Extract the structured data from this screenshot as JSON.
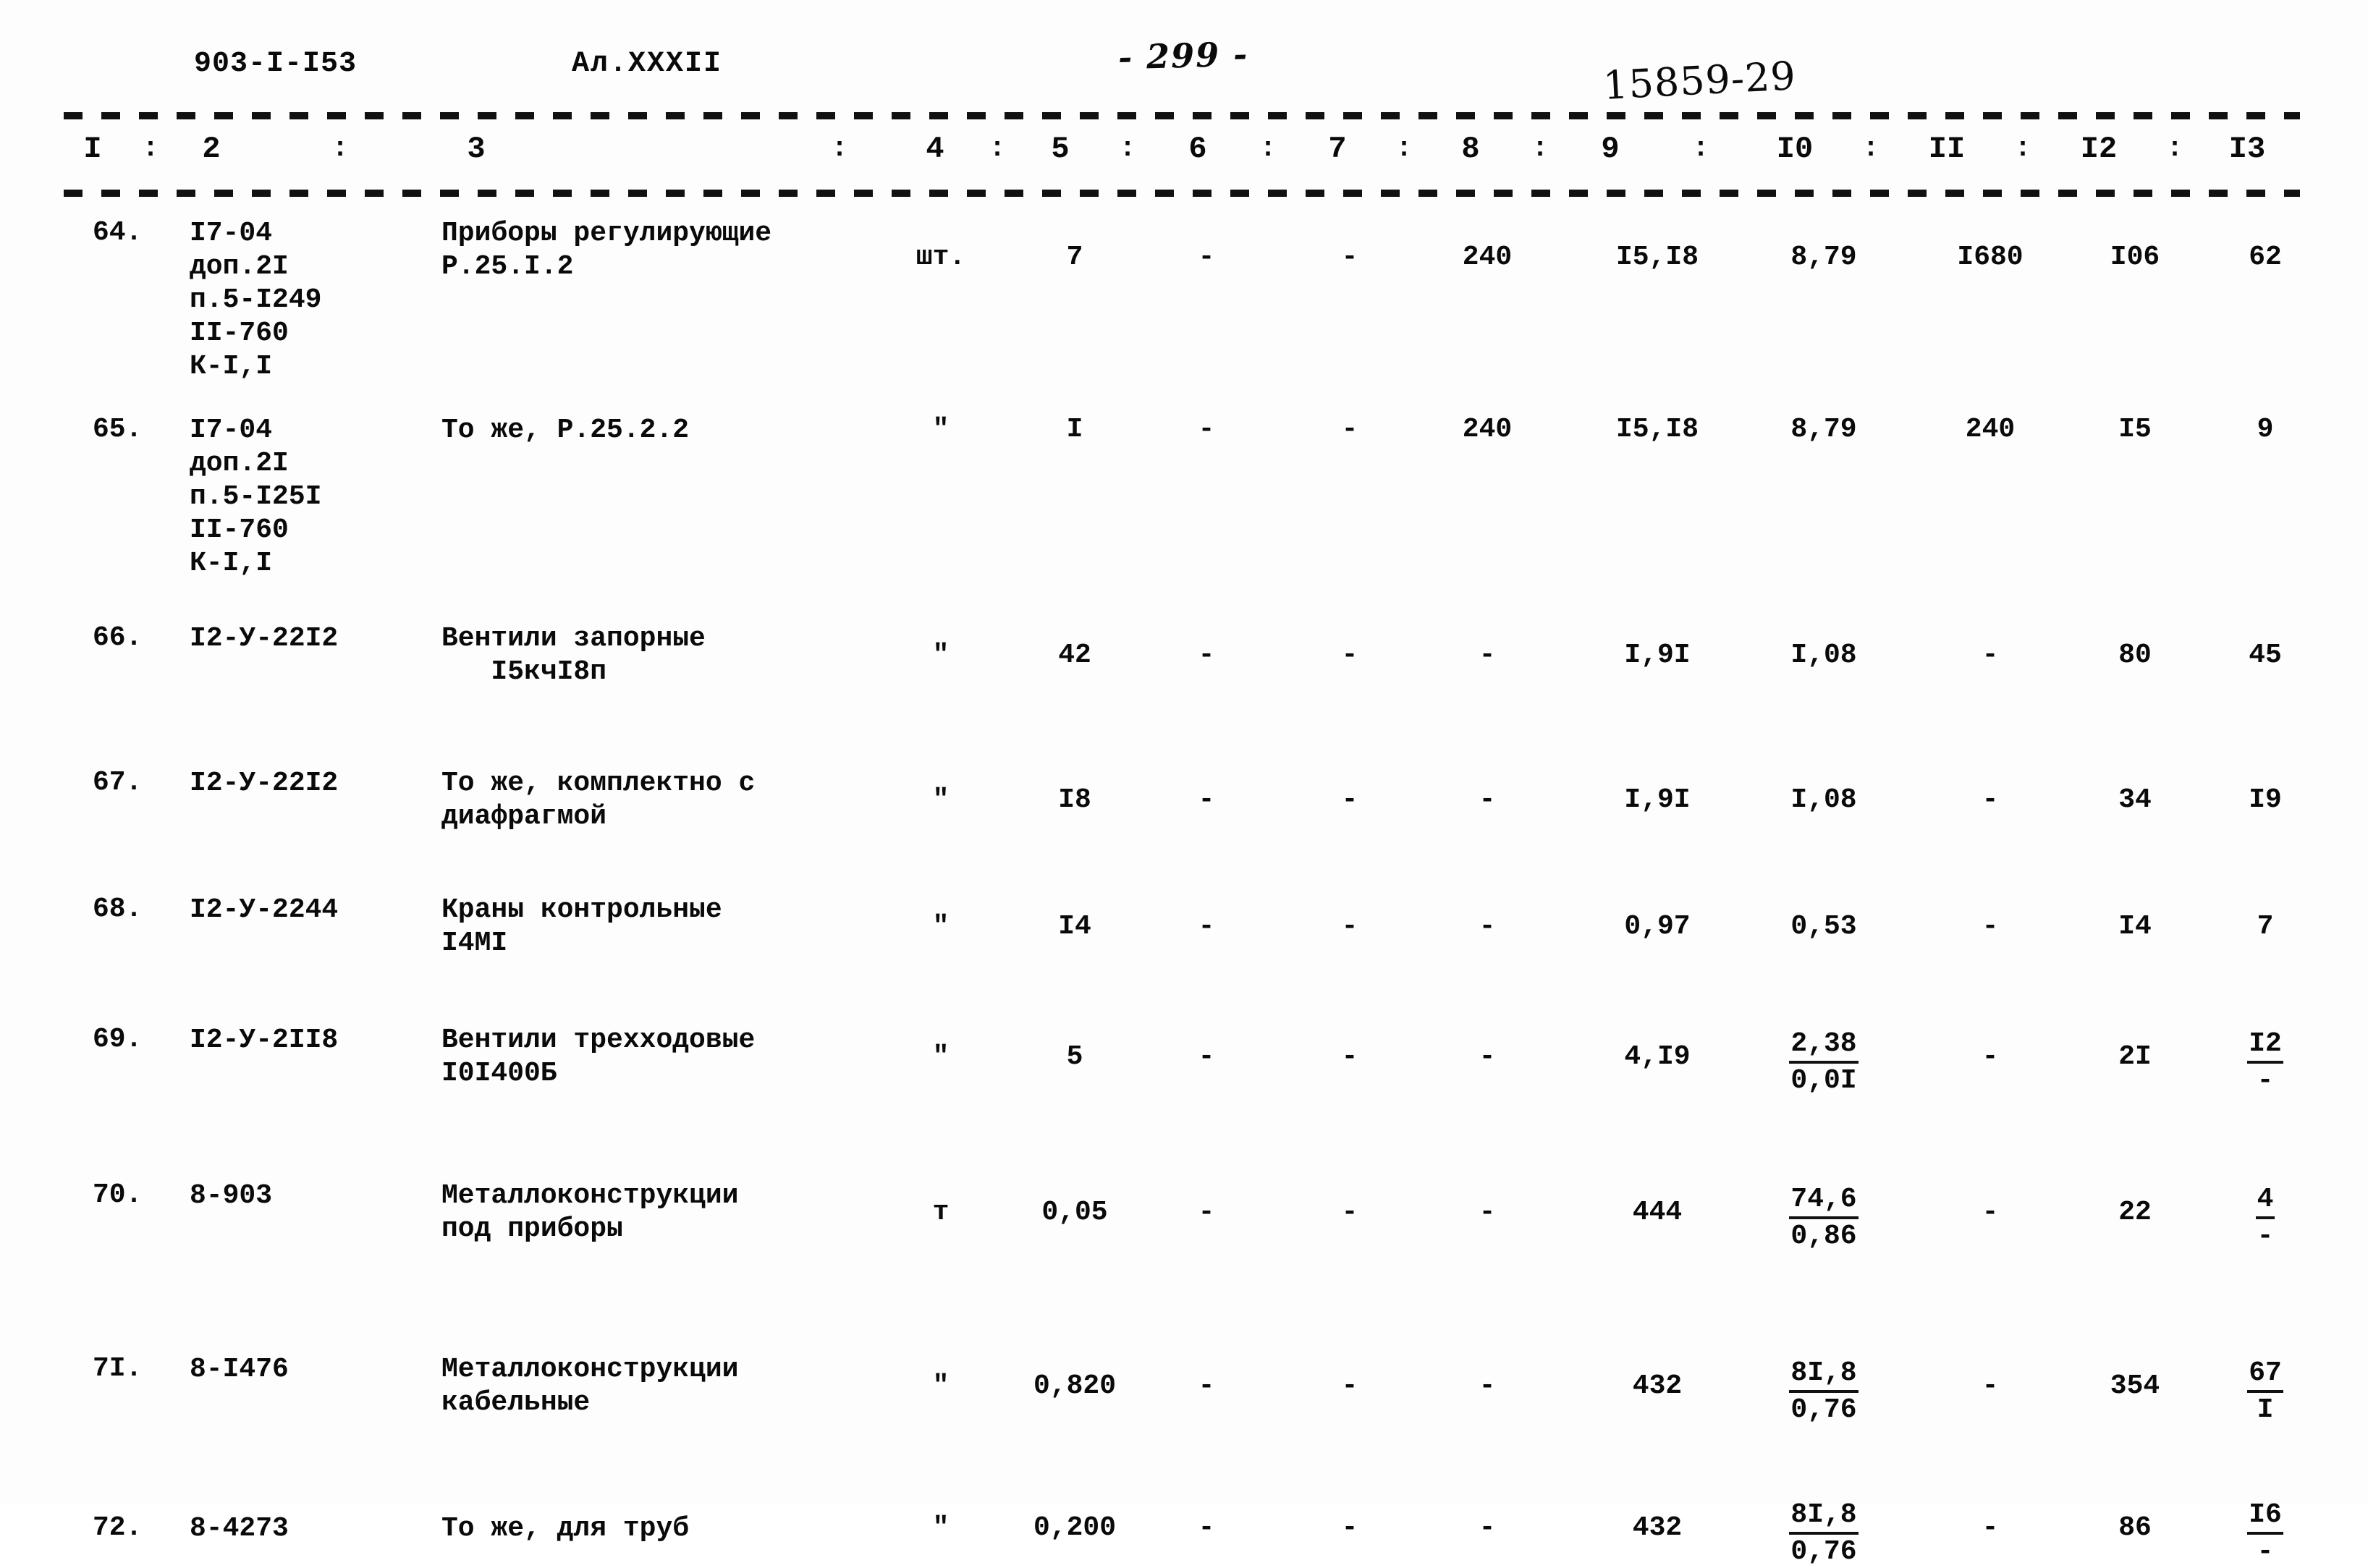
{
  "header": {
    "doc_code": "903-I-I53",
    "album": "Ал.XXXII",
    "page_number": "- 299 -",
    "stamp": "15859-29"
  },
  "table": {
    "column_headers": [
      "I",
      "2",
      "3",
      "4",
      "5",
      "6",
      "7",
      "8",
      "9",
      "I0",
      "II",
      "I2",
      "I3"
    ],
    "column_separator": ":",
    "rows": [
      {
        "num": "64.",
        "code": "I7-04\nдоп.2I\nп.5-I249\nII-760\nК-I,I",
        "name": "Приборы регулирующие\nР.25.I.2",
        "c4": "шт.",
        "c5": "7",
        "c6": "-",
        "c7": "-",
        "c8": "240",
        "c9": "I5,I8",
        "c10": "8,79",
        "c11": "I680",
        "c12": "I06",
        "c13": "62"
      },
      {
        "num": "65.",
        "code": "I7-04\nдоп.2I\nп.5-I25I\nII-760\nК-I,I",
        "name": "То же, Р.25.2.2",
        "c4": "\"",
        "c5": "I",
        "c6": "-",
        "c7": "-",
        "c8": "240",
        "c9": "I5,I8",
        "c10": "8,79",
        "c11": "240",
        "c12": "I5",
        "c13": "9"
      },
      {
        "num": "66.",
        "code": "I2-У-22I2",
        "name": "Вентили запорные\n   I5кчI8п",
        "c4": "\"",
        "c5": "42",
        "c6": "-",
        "c7": "-",
        "c8": "-",
        "c9": "I,9I",
        "c10": "I,08",
        "c11": "-",
        "c12": "80",
        "c13": "45"
      },
      {
        "num": "67.",
        "code": "I2-У-22I2",
        "name": "То же, комплектно с\nдиафрагмой",
        "c4": "\"",
        "c5": "I8",
        "c6": "-",
        "c7": "-",
        "c8": "-",
        "c9": "I,9I",
        "c10": "I,08",
        "c11": "-",
        "c12": "34",
        "c13": "I9"
      },
      {
        "num": "68.",
        "code": "I2-У-2244",
        "name": "Краны контрольные\nI4МI",
        "c4": "\"",
        "c5": "I4",
        "c6": "-",
        "c7": "-",
        "c8": "-",
        "c9": "0,97",
        "c10": "0,53",
        "c11": "-",
        "c12": "I4",
        "c13": "7"
      },
      {
        "num": "69.",
        "code": "I2-У-2II8",
        "name": "Вентили трехходовые\nI0I400Б",
        "c4": "\"",
        "c5": "5",
        "c6": "-",
        "c7": "-",
        "c8": "-",
        "c9": "4,I9",
        "c10_frac": {
          "top": "2,38",
          "bottom": "0,0I"
        },
        "c11": "-",
        "c12": "2I",
        "c13_frac": {
          "top": "I2",
          "bottom": "-"
        }
      },
      {
        "num": "70.",
        "code": "8-903",
        "name": "Металлоконструкции\nпод приборы",
        "c4": "т",
        "c5": "0,05",
        "c6": "-",
        "c7": "-",
        "c8": "-",
        "c9": "444",
        "c10_frac": {
          "top": "74,6",
          "bottom": "0,86"
        },
        "c11": "-",
        "c12": "22",
        "c13_frac": {
          "top": "4",
          "bottom": "-"
        }
      },
      {
        "num": "7I.",
        "code": "8-I476",
        "name": "Металлоконструкции\nкабельные",
        "c4": "\"",
        "c5": "0,820",
        "c6": "-",
        "c7": "-",
        "c8": "-",
        "c9": "432",
        "c10_frac": {
          "top": "8I,8",
          "bottom": "0,76"
        },
        "c11": "-",
        "c12": "354",
        "c13_frac": {
          "top": "67",
          "bottom": "I"
        }
      },
      {
        "num": "72.",
        "code": "8-4273",
        "name": "То же, для труб",
        "c4": "\"",
        "c5": "0,200",
        "c6": "-",
        "c7": "-",
        "c8": "-",
        "c9": "432",
        "c10_frac": {
          "top": "8I,8",
          "bottom": "0,76"
        },
        "c11": "-",
        "c12": "86",
        "c13_frac": {
          "top": "I6",
          "bottom": "-"
        }
      }
    ]
  }
}
